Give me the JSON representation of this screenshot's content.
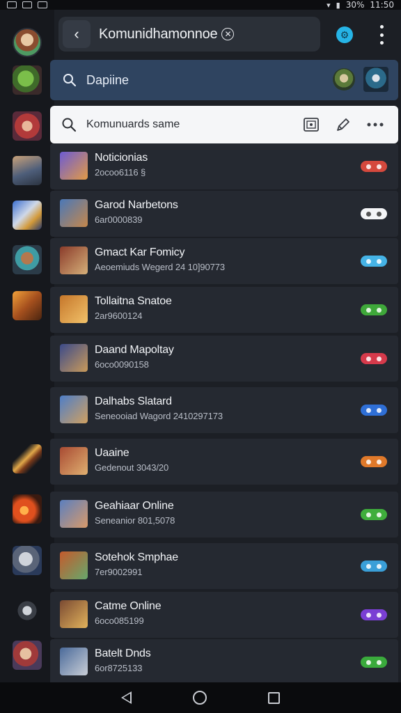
{
  "status_bar": {
    "battery": "30%",
    "time": "11:50"
  },
  "header": {
    "title": "Komunidhamonnoe",
    "back_icon": "arrow-left-icon",
    "settings_icon": "gear-icon",
    "menu_icon": "more-vertical-icon",
    "accent": "#26b4e6"
  },
  "search": {
    "label": "Dapiine"
  },
  "search2": {
    "label": "Komunuards same"
  },
  "list": {
    "items": [
      {
        "name": "Noticionias",
        "sub": "2ocoo6116 §",
        "toggle_color": "#d5493d",
        "thumb_a": "#6c5bd4",
        "thumb_b": "#e29a46"
      },
      {
        "name": "Garod Narbetons",
        "sub": "6ar0000839",
        "toggle_color": "#f4f5f7",
        "thumb_a": "#4a78b8",
        "thumb_b": "#c5874b"
      },
      {
        "name": "Gmact Kar Fomicy",
        "sub": "Aeoemiuds Wegerd 24 10]90773",
        "toggle_color": "#45b3e6",
        "thumb_a": "#8a3b2a",
        "thumb_b": "#d6b07a"
      },
      {
        "name": "Tollaitna Snatoe",
        "sub": "2ar9600124",
        "toggle_color": "#3fa83a",
        "thumb_a": "#c5762a",
        "thumb_b": "#f2c26a"
      },
      {
        "name": "Daand Mapoltay",
        "sub": "6oco0090158",
        "toggle_color": "#d63a4b",
        "thumb_a": "#3b4a8a",
        "thumb_b": "#c99a5a"
      },
      {
        "name": "Dalhabs Slatard",
        "sub": "Seneooiad Wagord 2410297173",
        "toggle_color": "#2f6fd6",
        "thumb_a": "#4e7ec8",
        "thumb_b": "#d0a060"
      },
      {
        "name": "Uaaine",
        "sub": "Gedenout 3043/20",
        "toggle_color": "#e0792a",
        "thumb_a": "#a84a32",
        "thumb_b": "#e0b071"
      },
      {
        "name": "Geahiaar Online",
        "sub": "Seneanior 801,5078",
        "toggle_color": "#3fae3c",
        "thumb_a": "#5b7fbf",
        "thumb_b": "#d89a6a"
      },
      {
        "name": "Sotehok Smphae",
        "sub": "7er9002991",
        "toggle_color": "#3a9fd8",
        "thumb_a": "#c55a2c",
        "thumb_b": "#66a86c"
      },
      {
        "name": "Catme Online",
        "sub": "6oco085199",
        "toggle_color": "#7a3fd4",
        "thumb_a": "#7a4a32",
        "thumb_b": "#e2b35c"
      },
      {
        "name": "Batelt Dnds",
        "sub": "6or8725133",
        "toggle_color": "#3aaa3c",
        "thumb_a": "#4a6a9a",
        "thumb_b": "#c9ced6"
      }
    ]
  },
  "rail": {
    "icons": [
      "avatar",
      "orc-icon",
      "jester-icon",
      "knight-icon",
      "warrior-icon",
      "robot-icon",
      "tank-icon",
      "blade-icon",
      "fire-icon",
      "helmet-icon",
      "star-emblem-icon",
      "mage-icon"
    ]
  },
  "nav": {
    "back_icon": "nav-back-icon",
    "home_icon": "nav-home-icon",
    "recent_icon": "nav-recent-icon"
  }
}
